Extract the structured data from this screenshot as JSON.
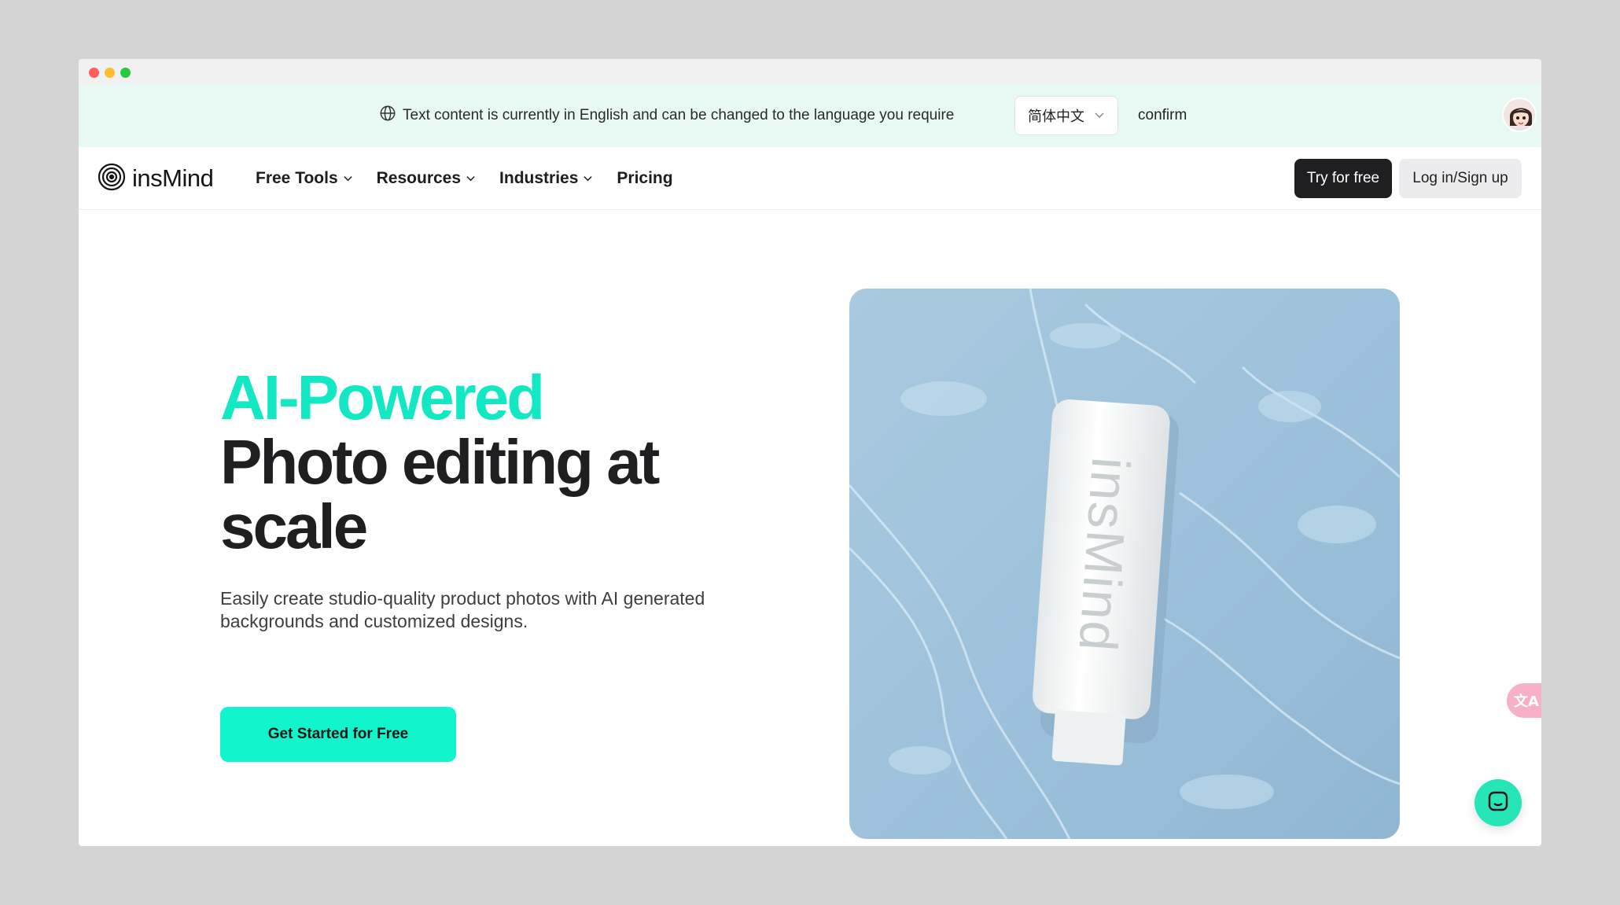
{
  "language_banner": {
    "message": "Text content is currently in English and can be changed to the language you require",
    "selected_language": "简体中文",
    "confirm_label": "confirm"
  },
  "nav": {
    "logo_text": "insMind",
    "menu": [
      {
        "label": "Free Tools",
        "has_dropdown": true
      },
      {
        "label": "Resources",
        "has_dropdown": true
      },
      {
        "label": "Industries",
        "has_dropdown": true
      },
      {
        "label": "Pricing",
        "has_dropdown": false
      }
    ],
    "try_label": "Try for free",
    "login_label": "Log in/Sign up"
  },
  "hero": {
    "headline_accent": "AI-Powered",
    "headline_line1": "Photo editing at",
    "headline_line2": "scale",
    "subtext": "Easily create studio-quality product photos with AI generated backgrounds and customized designs.",
    "cta_label": "Get Started for Free",
    "product_brand": "insMind"
  },
  "floating": {
    "translate_glyph": "文A"
  },
  "colors": {
    "accent": "#12e9c4",
    "cta": "#12f5cc",
    "banner_bg": "#e8f9f4",
    "dark_button": "#1f1f22"
  }
}
